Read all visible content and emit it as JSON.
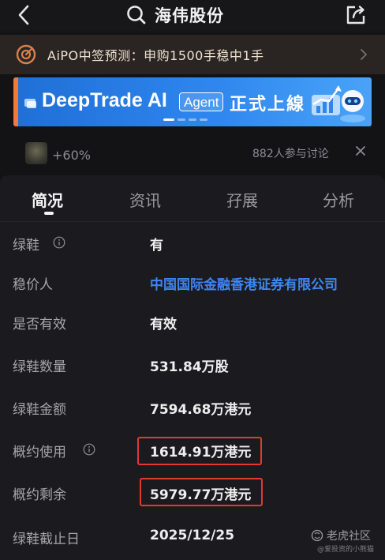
{
  "header": {
    "title": "海伟股份",
    "back_icon": "chevron-left-icon",
    "search_icon": "search-icon",
    "share_icon": "share-icon"
  },
  "aipo_banner": {
    "text": "AiPO中签预测：申购1500手稳中1手",
    "icon": "target-icon",
    "accent": "#d8804e"
  },
  "ad_banner": {
    "brand": "DeepTrade AI",
    "badge": "Agent",
    "tail": "正式上線"
  },
  "discussion": {
    "change": "+60%",
    "participants": "882人参与讨论"
  },
  "tabs": [
    {
      "label": "简况",
      "active": true
    },
    {
      "label": "资讯",
      "active": false
    },
    {
      "label": "孖展",
      "active": false
    },
    {
      "label": "分析",
      "active": false
    }
  ],
  "rows": [
    {
      "label": "绿鞋",
      "value": "有",
      "has_info": true
    },
    {
      "label": "稳价人",
      "value": "中国国际金融香港证券有限公司",
      "has_info": false,
      "link": true
    },
    {
      "label": "是否有效",
      "value": "有效",
      "has_info": false
    },
    {
      "label": "绿鞋数量",
      "value": "531.84万股",
      "has_info": false
    },
    {
      "label": "绿鞋金额",
      "value": "7594.68万港元",
      "has_info": false
    },
    {
      "label": "概约使用",
      "value": "1614.91万港元",
      "has_info": true,
      "highlighted": true
    },
    {
      "label": "概约剩余",
      "value": "5979.77万港元",
      "has_info": false,
      "highlighted": true
    },
    {
      "label": "绿鞋截止日",
      "value": "2025/12/25",
      "has_info": false
    }
  ],
  "watermark": {
    "name": "老虎社区",
    "handle": "@爱投资的小熊猫"
  },
  "colors": {
    "background": "#131316",
    "card": "#1b1b1f",
    "link": "#3e86f0",
    "highlight": "#e23a33"
  }
}
